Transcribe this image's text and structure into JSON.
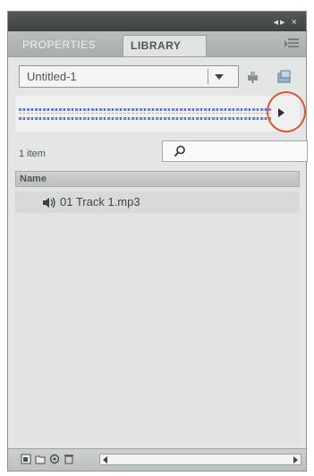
{
  "window": {
    "controls": "◂▸ ×"
  },
  "tabs": [
    {
      "label": "PROPERTIES",
      "active": false
    },
    {
      "label": "LIBRARY",
      "active": true
    }
  ],
  "library": {
    "document_select": "Untitled-1",
    "item_count": "1 item",
    "search_placeholder": "",
    "column_header": "Name",
    "items": [
      {
        "name": "01 Track 1.mp3",
        "icon": "sound-icon"
      }
    ]
  },
  "colors": {
    "highlight_circle": "#d6593c",
    "waveform": "#5b6fbd",
    "panel_bg": "#e4e6e5"
  }
}
